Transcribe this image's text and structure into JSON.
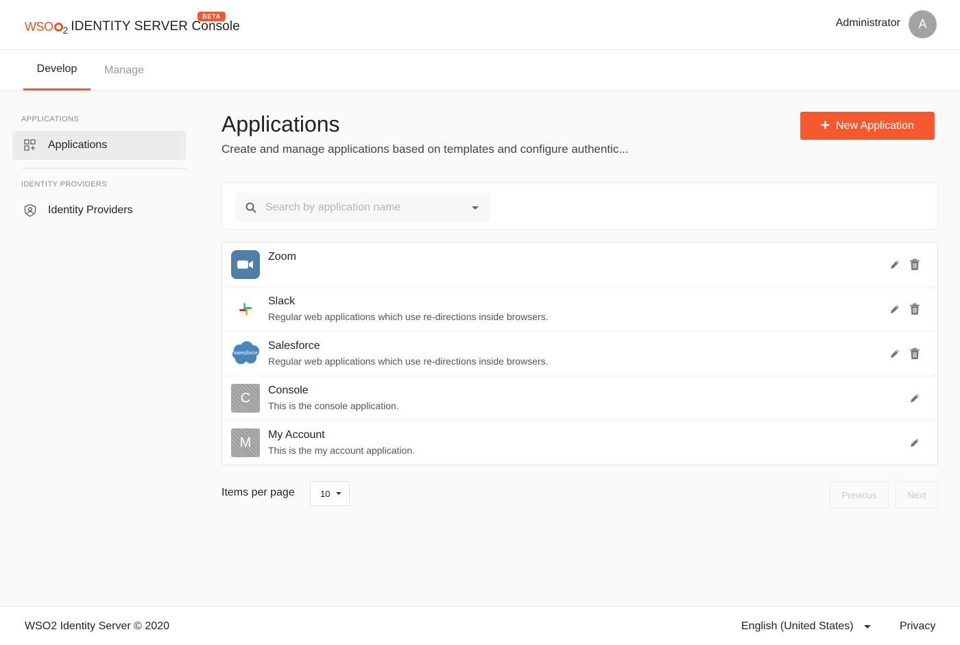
{
  "header": {
    "logo_wso": "WSO",
    "logo_two": "2",
    "logo_text": "IDENTITY SERVER Console",
    "beta": "BETA",
    "user_name": "Administrator",
    "avatar_letter": "A"
  },
  "tabs": [
    {
      "label": "Develop",
      "active": true
    },
    {
      "label": "Manage",
      "active": false
    }
  ],
  "sidebar": {
    "sections": [
      {
        "heading": "APPLICATIONS",
        "item": {
          "label": "Applications",
          "icon": "grid-icon",
          "active": true
        }
      },
      {
        "heading": "IDENTITY PROVIDERS",
        "item": {
          "label": "Identity Providers",
          "icon": "shield-user-icon",
          "active": false
        }
      }
    ]
  },
  "main": {
    "title": "Applications",
    "description": "Create and manage applications based on templates and configure authentic...",
    "new_button": "New Application",
    "search": {
      "placeholder": "Search by application name"
    },
    "applications": [
      {
        "name": "Zoom",
        "description": "",
        "logo": "zoom-logo",
        "deletable": true
      },
      {
        "name": "Slack",
        "description": "Regular web applications which use re-directions inside browsers.",
        "logo": "slack-logo",
        "deletable": true
      },
      {
        "name": "Salesforce",
        "description": "Regular web applications which use re-directions inside browsers.",
        "logo": "salesforce-logo",
        "logo_text": "salesforce",
        "deletable": true
      },
      {
        "name": "Console",
        "description": "This is the console application.",
        "logo": "letter-logo",
        "logo_letter": "C",
        "deletable": false
      },
      {
        "name": "My Account",
        "description": "This is the my account application.",
        "logo": "letter-logo",
        "logo_letter": "M",
        "deletable": false
      }
    ],
    "pagination": {
      "items_per_page_label": "Items per page",
      "items_per_page": "10",
      "previous": "Previous",
      "next": "Next"
    }
  },
  "footer": {
    "copyright": "WSO2 Identity Server © 2020",
    "language": "English (United States)",
    "privacy": "Privacy"
  },
  "colors": {
    "accent": "#f5592f",
    "zoom": "#4f7ea6",
    "salesforce": "#4a87b9"
  }
}
